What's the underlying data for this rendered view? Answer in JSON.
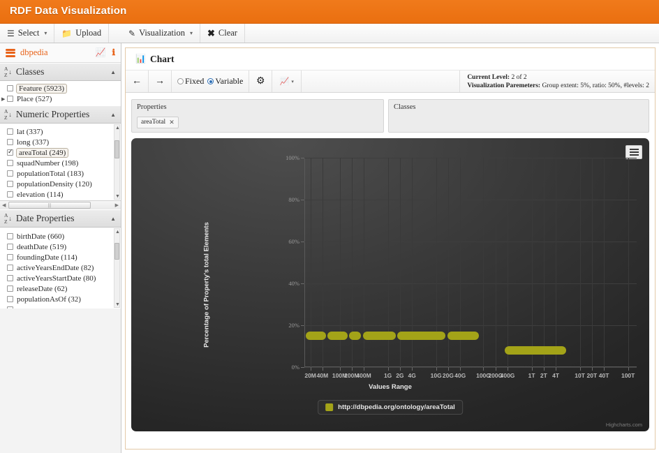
{
  "app": {
    "title": "RDF Data Visualization",
    "brand_color": "#ef7518"
  },
  "menubar": {
    "left_group": [
      {
        "label": "Select",
        "icon": "database-icon",
        "caret": "▾"
      },
      {
        "label": "Upload",
        "icon": "folder-icon",
        "caret": ""
      }
    ],
    "right_group": [
      {
        "label": "Visualization",
        "icon": "pencil-icon",
        "caret": "▾"
      },
      {
        "label": "Clear",
        "icon": "close-icon",
        "caret": ""
      }
    ]
  },
  "sidebar": {
    "dataset": {
      "name": "dbpedia",
      "chart_action": "chart-icon",
      "info_action": "info-icon"
    },
    "sections": [
      {
        "title": "Classes",
        "items": [
          {
            "label": "Feature (5923)",
            "checked": false,
            "highlighted": true,
            "expandable": false
          },
          {
            "label": "Place (527)",
            "checked": false,
            "highlighted": false,
            "expandable": true
          }
        ]
      },
      {
        "title": "Numeric Properties",
        "items": [
          {
            "label": "lat (337)",
            "checked": false,
            "highlighted": false,
            "expandable": false
          },
          {
            "label": "long (337)",
            "checked": false,
            "highlighted": false,
            "expandable": false
          },
          {
            "label": "areaTotal (249)",
            "checked": true,
            "highlighted": true,
            "expandable": false
          },
          {
            "label": "squadNumber (198)",
            "checked": false,
            "highlighted": false,
            "expandable": false
          },
          {
            "label": "populationTotal (183)",
            "checked": false,
            "highlighted": false,
            "expandable": false
          },
          {
            "label": "populationDensity (120)",
            "checked": false,
            "highlighted": false,
            "expandable": false
          },
          {
            "label": "elevation (114)",
            "checked": false,
            "highlighted": false,
            "expandable": false
          }
        ]
      },
      {
        "title": "Date Properties",
        "items": [
          {
            "label": "birthDate (660)",
            "checked": false,
            "highlighted": false,
            "expandable": false
          },
          {
            "label": "deathDate (519)",
            "checked": false,
            "highlighted": false,
            "expandable": false
          },
          {
            "label": "foundingDate (114)",
            "checked": false,
            "highlighted": false,
            "expandable": false
          },
          {
            "label": "activeYearsEndDate (82)",
            "checked": false,
            "highlighted": false,
            "expandable": false
          },
          {
            "label": "activeYearsStartDate (80)",
            "checked": false,
            "highlighted": false,
            "expandable": false
          },
          {
            "label": "releaseDate (62)",
            "checked": false,
            "highlighted": false,
            "expandable": false
          },
          {
            "label": "populationAsOf (32)",
            "checked": false,
            "highlighted": false,
            "expandable": false
          }
        ]
      }
    ]
  },
  "panel": {
    "title": "Chart",
    "title_icon": "bar-chart-icon",
    "toolbar": {
      "back": "←",
      "forward": "→",
      "mode_fixed_label": "Fixed",
      "mode_variable_label": "Variable",
      "mode_selected": "Variable",
      "settings_icon": "gear-icon",
      "charttype_icon": "chart-type-icon",
      "charttype_caret": "▾",
      "current_level_label": "Current Level:",
      "current_level_value": "2 of 2",
      "params_label": "Visualization Paremeters:",
      "params_value": "Group extent: 5%, ratio: 50%, #levels: 2"
    },
    "selection": {
      "properties_header": "Properties",
      "classes_header": "Classes",
      "property_tags": [
        {
          "label": "areaTotal",
          "remove": "✕"
        }
      ],
      "class_tags": []
    }
  },
  "chart_data": {
    "type": "bar",
    "title": "",
    "xlabel": "Values Range",
    "ylabel": "Percentage of Property's total Elements",
    "ylim": [
      0,
      100
    ],
    "yticks": [
      0,
      20,
      40,
      60,
      80,
      100
    ],
    "ytick_labels": [
      "0%",
      "20%",
      "40%",
      "60%",
      "80%",
      "100%"
    ],
    "grid": true,
    "legend_position": "bottom",
    "background": "#2c2c2c",
    "series_color": "#a3a318",
    "legend": [
      "http://dbpedia.org/ontology/areaTotal"
    ],
    "credit": "Highcharts.com",
    "xtick_labels": [
      "20M",
      "40M",
      "100M",
      "200M",
      "400M",
      "1G",
      "2G",
      "4G",
      "10G",
      "20G",
      "40G",
      "100G",
      "200G",
      "400G",
      "1T",
      "2T",
      "4T",
      "10T",
      "20T",
      "40T",
      "100T"
    ],
    "xtick_positions": [
      3.5,
      10.5,
      20.5,
      27.5,
      34.5,
      48.5,
      55.5,
      62.5,
      76.5,
      83.5,
      90.5,
      104,
      111,
      118,
      132,
      139,
      146,
      160,
      167,
      174,
      188
    ],
    "bars": [
      {
        "x_start": 1.0,
        "x_end": 12.5,
        "value": 15
      },
      {
        "x_start": 13.5,
        "x_end": 25.0,
        "value": 15
      },
      {
        "x_start": 26.0,
        "x_end": 33.0,
        "value": 15
      },
      {
        "x_start": 34.0,
        "x_end": 53.0,
        "value": 15
      },
      {
        "x_start": 54.0,
        "x_end": 82.0,
        "value": 15
      },
      {
        "x_start": 83.0,
        "x_end": 101.5,
        "value": 15
      },
      {
        "x_start": 116.5,
        "x_end": 152.0,
        "value": 8
      }
    ]
  }
}
